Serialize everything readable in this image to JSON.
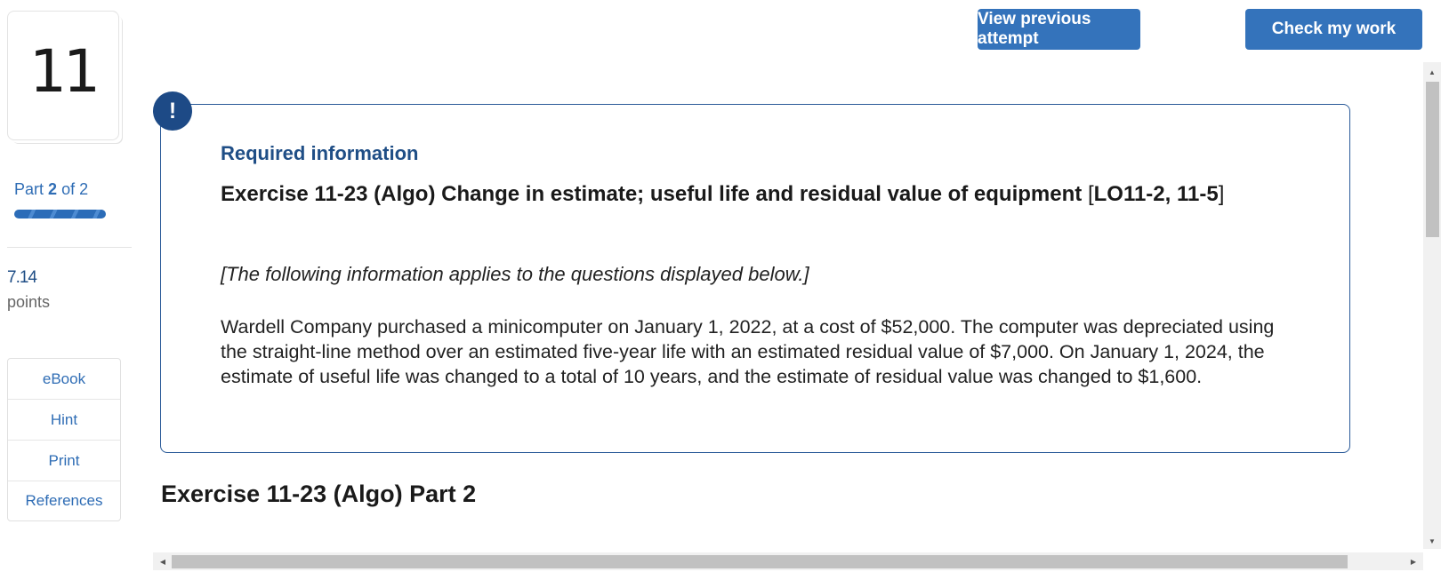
{
  "question": {
    "number": "11"
  },
  "progress": {
    "part_word": "Part",
    "part_current": "2",
    "part_of": "of 2",
    "fraction_complete": 1.0
  },
  "points": {
    "value": "7.14",
    "label": "points"
  },
  "tools": [
    {
      "label": "eBook"
    },
    {
      "label": "Hint"
    },
    {
      "label": "Print"
    },
    {
      "label": "References"
    }
  ],
  "toolbar": {
    "view_previous_label": "View previous attempt",
    "check_work_label": "Check my work"
  },
  "info": {
    "icon_glyph": "!",
    "heading": "Required information",
    "title_main": "Exercise 11-23 (Algo) Change in estimate; useful life and residual value of equipment ",
    "title_bracket_open": "[",
    "title_refs": "LO11-2, 11-5",
    "title_bracket_close": "]",
    "note": "[The following information applies to the questions displayed below.]",
    "body": "Wardell Company purchased a minicomputer on January 1, 2022, at a cost of $52,000. The computer was depreciated using the straight-line method over an estimated five-year life with an estimated residual value of $7,000. On January 1, 2024, the estimate of useful life was changed to a total of 10 years, and the estimate of residual value was changed to $1,600."
  },
  "part_heading": "Exercise 11-23 (Algo) Part 2",
  "colors": {
    "accent": "#3473bb",
    "navy": "#1d4a86",
    "link": "#2f6db5"
  }
}
